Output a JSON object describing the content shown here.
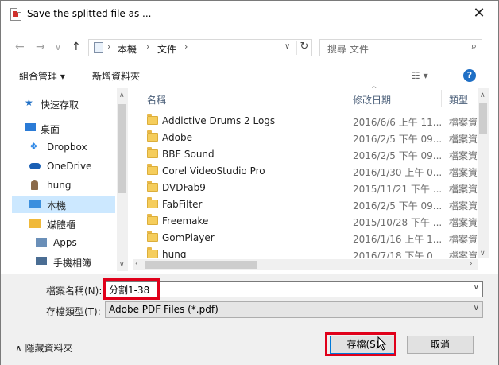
{
  "window": {
    "title": "Save the splitted file as ...",
    "close": "✕"
  },
  "nav": {
    "back": "←",
    "forward": "→",
    "recent": "∨",
    "up": "↑",
    "crumbs": [
      "本機",
      "文件"
    ],
    "refresh": "↻",
    "search_placeholder": "搜尋 文件"
  },
  "toolbar": {
    "organize": "組合管理 ▾",
    "new_folder": "新增資料夾",
    "help": "?"
  },
  "sidebar": {
    "items": [
      {
        "label": "快速存取",
        "icon": "star-icon"
      },
      {
        "label": "桌面",
        "icon": "desktop-icon"
      },
      {
        "label": "Dropbox",
        "icon": "dropbox-icon"
      },
      {
        "label": "OneDrive",
        "icon": "cloud-icon"
      },
      {
        "label": "hung",
        "icon": "user-icon"
      },
      {
        "label": "本機",
        "icon": "computer-icon"
      },
      {
        "label": "媒體櫃",
        "icon": "library-icon"
      },
      {
        "label": "Apps",
        "icon": "apps-icon"
      },
      {
        "label": "手機相簿",
        "icon": "phone-album-icon"
      }
    ]
  },
  "columns": {
    "name": "名稱",
    "date": "修改日期",
    "type": "類型"
  },
  "files": [
    {
      "name": "Addictive Drums 2 Logs",
      "date": "2016/6/6 上午 11...",
      "type": "檔案資"
    },
    {
      "name": "Adobe",
      "date": "2016/2/5 下午 09...",
      "type": "檔案資"
    },
    {
      "name": "BBE Sound",
      "date": "2016/2/5 下午 09...",
      "type": "檔案資"
    },
    {
      "name": "Corel VideoStudio Pro",
      "date": "2016/1/30 上午 0...",
      "type": "檔案資"
    },
    {
      "name": "DVDFab9",
      "date": "2015/11/21 下午 ...",
      "type": "檔案資"
    },
    {
      "name": "FabFilter",
      "date": "2016/2/5 下午 09...",
      "type": "檔案資"
    },
    {
      "name": "Freemake",
      "date": "2015/10/28 下午 ...",
      "type": "檔案資"
    },
    {
      "name": "GomPlayer",
      "date": "2016/1/16 上午 1...",
      "type": "檔案資"
    },
    {
      "name": "hung",
      "date": "2016/7/18 下午 0...",
      "type": "檔案資"
    }
  ],
  "form": {
    "filename_label": "檔案名稱(N):",
    "filename_value": "分割1-38",
    "filetype_label": "存檔類型(T):",
    "filetype_value": "Adobe PDF Files (*.pdf)"
  },
  "footer": {
    "hide_folders": "∧  隱藏資料夾",
    "save": "存檔(S)",
    "cancel": "取消"
  },
  "colors": {
    "highlight": "#e0001a",
    "selection": "#cce8ff",
    "help": "#1f6fc5"
  }
}
